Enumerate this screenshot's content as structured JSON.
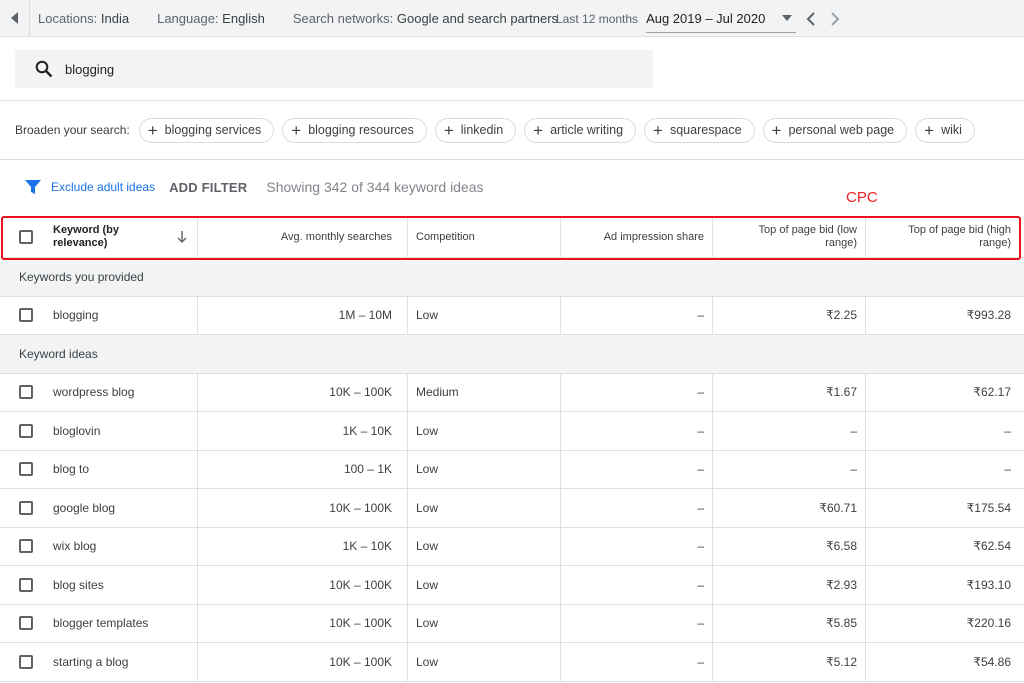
{
  "topbar": {
    "location_label": "Locations:",
    "location_value": "India",
    "language_label": "Language:",
    "language_value": "English",
    "network_label": "Search networks:",
    "network_value": "Google and search partners",
    "date_label": "Last 12 months",
    "date_value": "Aug 2019 – Jul 2020"
  },
  "search": {
    "value": "blogging"
  },
  "broaden": {
    "label": "Broaden your search:",
    "chips": [
      "blogging services",
      "blogging resources",
      "linkedin",
      "article writing",
      "squarespace",
      "personal web page",
      "wiki"
    ]
  },
  "filters": {
    "exclude_adult": "Exclude adult ideas",
    "add_filter": "ADD FILTER",
    "showing": "Showing 342 of 344 keyword ideas"
  },
  "annotation": {
    "text": "CPC",
    "color": "#e8131f"
  },
  "table": {
    "headers": {
      "keyword": "Keyword (by relevance)",
      "avg": "Avg. monthly searches",
      "competition": "Competition",
      "ad_share": "Ad impression share",
      "bid_low": "Top of page bid (low range)",
      "bid_high": "Top of page bid (high range)"
    },
    "group_provided": "Keywords you provided",
    "provided": [
      {
        "kw": "blogging",
        "avg": "1M – 10M",
        "comp": "Low",
        "ad": "–",
        "low": "₹2.25",
        "high": "₹993.28"
      }
    ],
    "group_ideas": "Keyword ideas",
    "ideas": [
      {
        "kw": "wordpress blog",
        "avg": "10K – 100K",
        "comp": "Medium",
        "ad": "–",
        "low": "₹1.67",
        "high": "₹62.17"
      },
      {
        "kw": "bloglovin",
        "avg": "1K – 10K",
        "comp": "Low",
        "ad": "–",
        "low": "–",
        "high": "–"
      },
      {
        "kw": "blog to",
        "avg": "100 – 1K",
        "comp": "Low",
        "ad": "–",
        "low": "–",
        "high": "–"
      },
      {
        "kw": "google blog",
        "avg": "10K – 100K",
        "comp": "Low",
        "ad": "–",
        "low": "₹60.71",
        "high": "₹175.54"
      },
      {
        "kw": "wix blog",
        "avg": "1K – 10K",
        "comp": "Low",
        "ad": "–",
        "low": "₹6.58",
        "high": "₹62.54"
      },
      {
        "kw": "blog sites",
        "avg": "10K – 100K",
        "comp": "Low",
        "ad": "–",
        "low": "₹2.93",
        "high": "₹193.10"
      },
      {
        "kw": "blogger templates",
        "avg": "10K – 100K",
        "comp": "Low",
        "ad": "–",
        "low": "₹5.85",
        "high": "₹220.16"
      },
      {
        "kw": "starting a blog",
        "avg": "10K – 100K",
        "comp": "Low",
        "ad": "–",
        "low": "₹5.12",
        "high": "₹54.86"
      }
    ]
  },
  "colors": {
    "accent": "#1a73e8",
    "annotation": "#e8131f"
  }
}
